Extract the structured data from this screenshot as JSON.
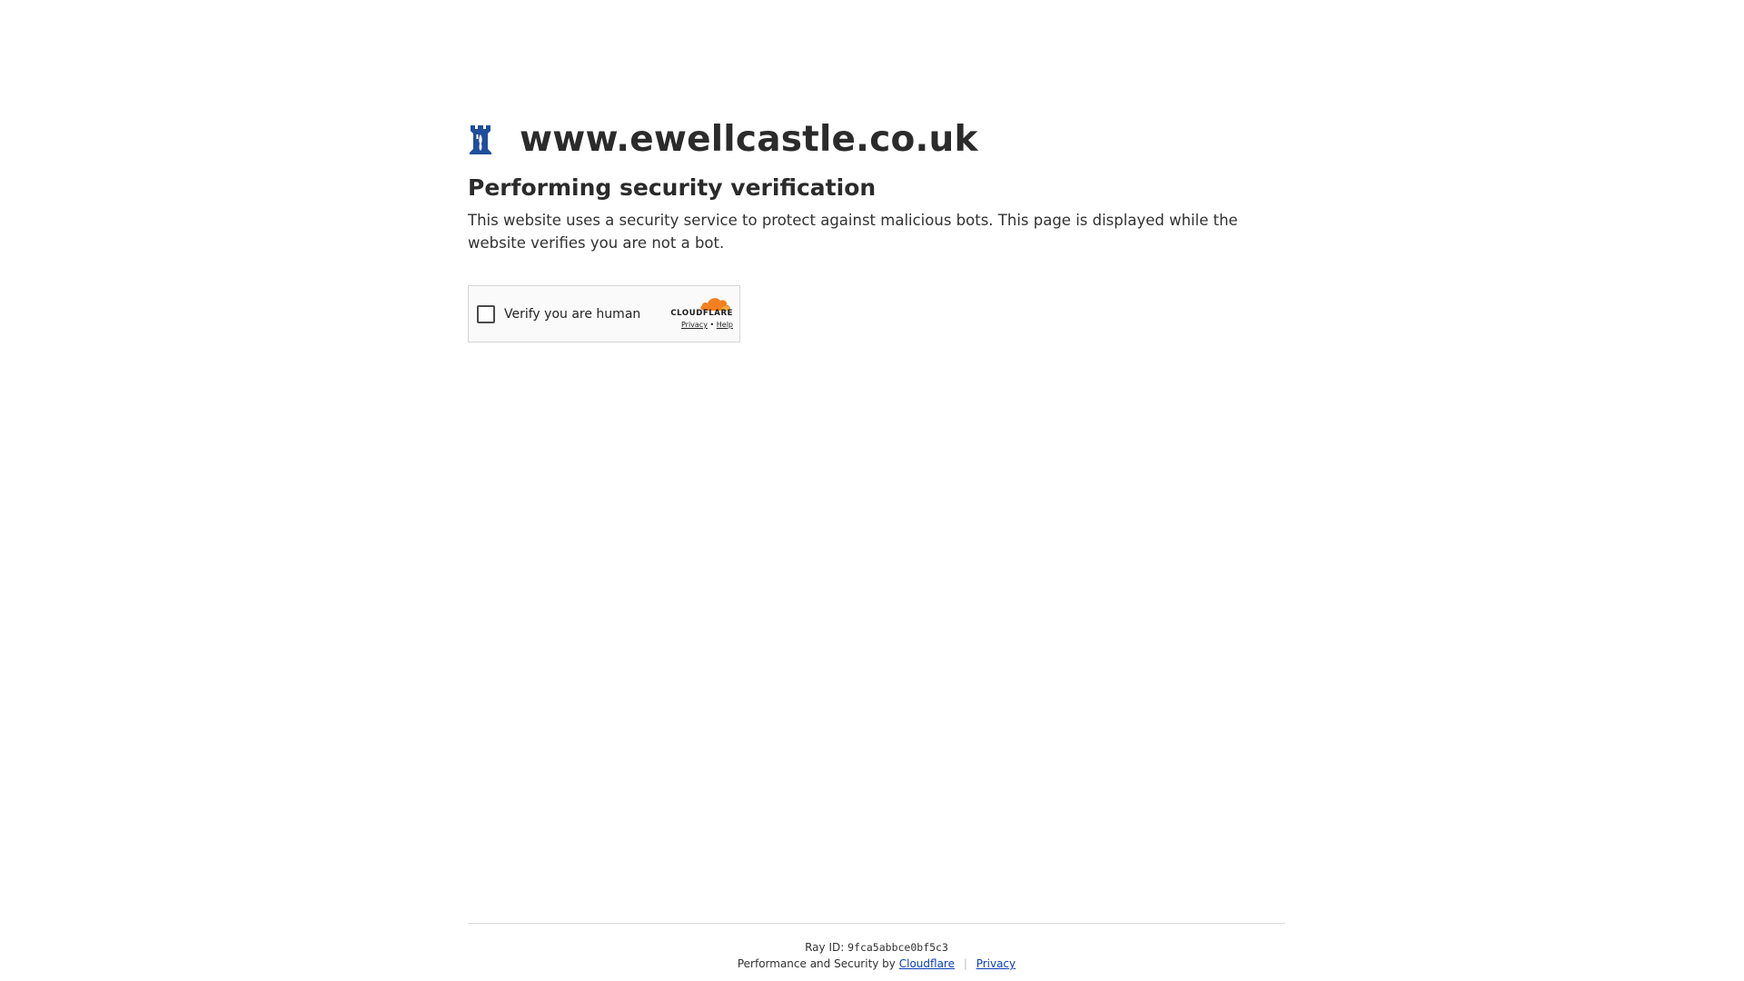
{
  "site": {
    "name": "www.ewellcastle.co.uk",
    "icon": "castle-tower-icon",
    "icon_color": "#1f4e9c"
  },
  "main": {
    "heading": "Performing security verification",
    "description": "This website uses a security service to protect against malicious bots. This page is displayed while the website verifies you are not a bot."
  },
  "widget": {
    "checkbox_label": "Verify you are human",
    "brand": "CLOUDFLARE",
    "brand_color": "#f38020",
    "privacy_link": "Privacy",
    "link_separator": "•",
    "help_link": "Help"
  },
  "footer": {
    "ray_label": "Ray ID:",
    "ray_id": "9fca5abbce0bf5c3",
    "performance_text": "Performance and Security by",
    "cloudflare_link": "Cloudflare",
    "separator": "|",
    "privacy_link": "Privacy",
    "link_color": "#0b3eb8"
  }
}
